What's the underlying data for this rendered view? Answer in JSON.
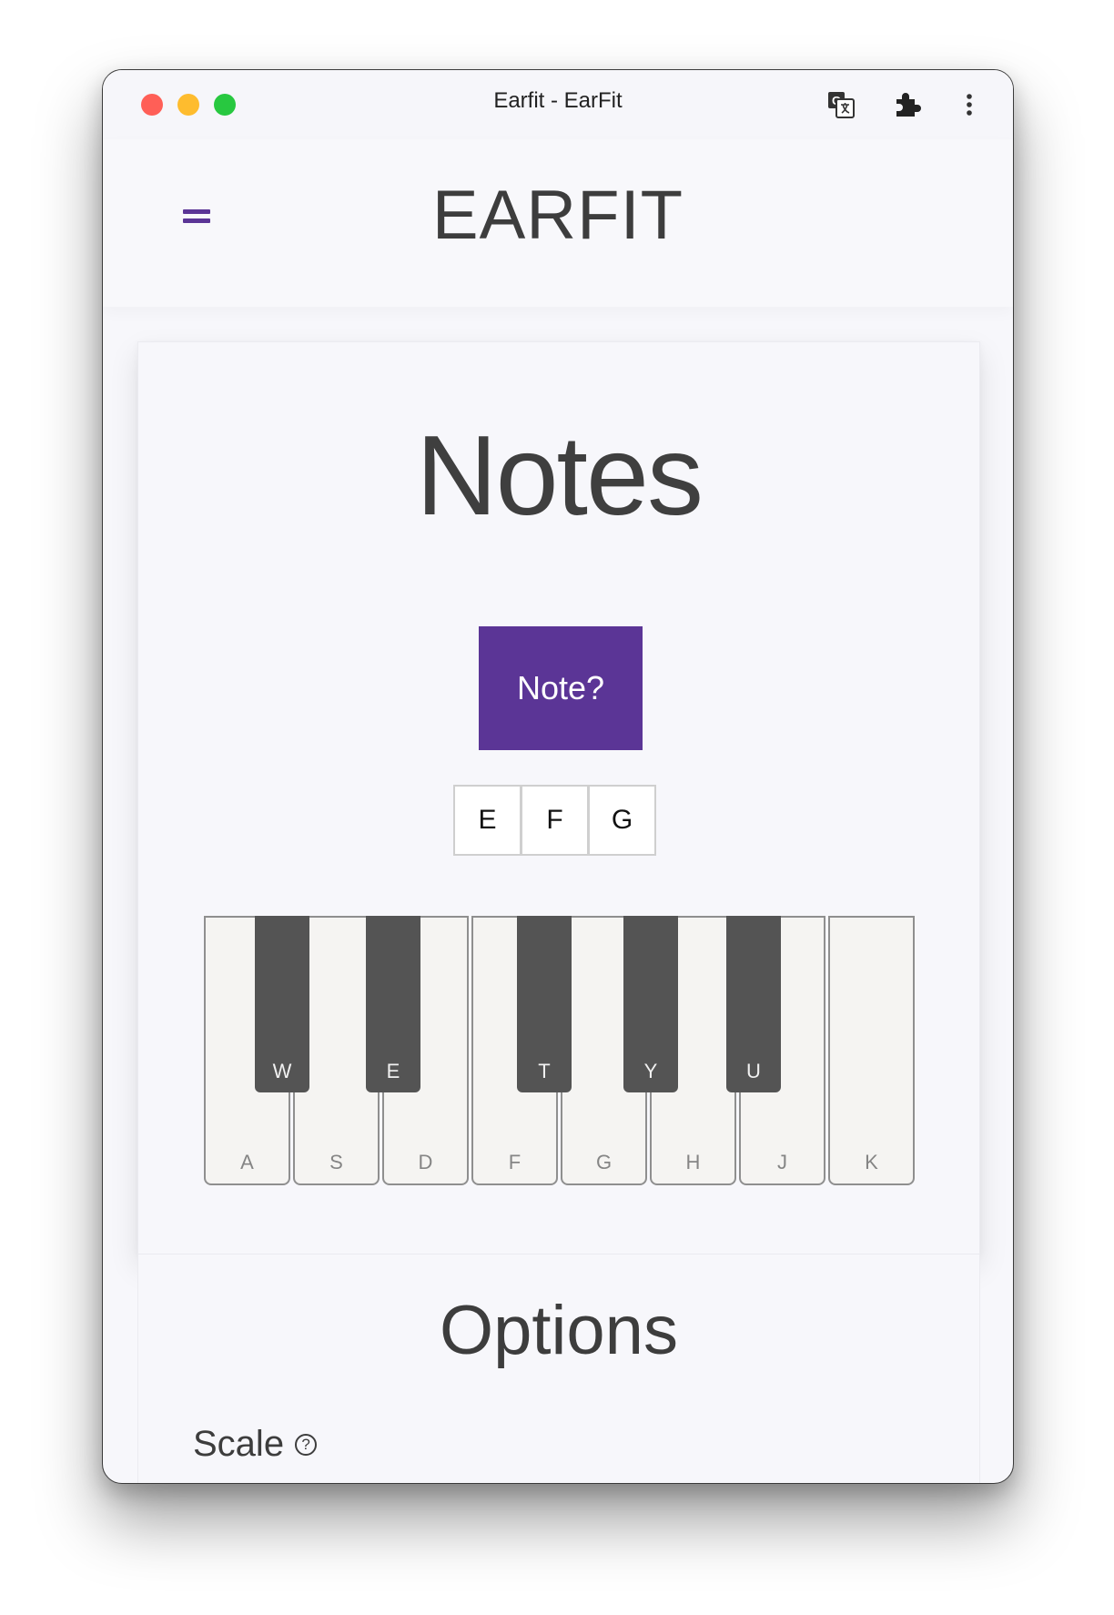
{
  "window": {
    "title": "Earfit - EarFit"
  },
  "toolbar_icons": [
    "translate-icon",
    "puzzle-extension-icon",
    "more-vertical-icon"
  ],
  "header": {
    "brand": "EARFIT",
    "menu_icon": "hamburger-menu-icon"
  },
  "exercise": {
    "heading": "Notes",
    "play_button": "Note?",
    "choices": [
      "E",
      "F",
      "G"
    ]
  },
  "piano": {
    "white_keys": [
      "A",
      "S",
      "D",
      "F",
      "G",
      "H",
      "J",
      "K"
    ],
    "black_keys": [
      "W",
      "E",
      "T",
      "Y",
      "U"
    ]
  },
  "options": {
    "heading": "Options",
    "scale_label": "Scale",
    "help_icon": "?"
  },
  "colors": {
    "accent": "#5b3596",
    "black_key": "#545454",
    "white_key": "#f5f4f2"
  }
}
